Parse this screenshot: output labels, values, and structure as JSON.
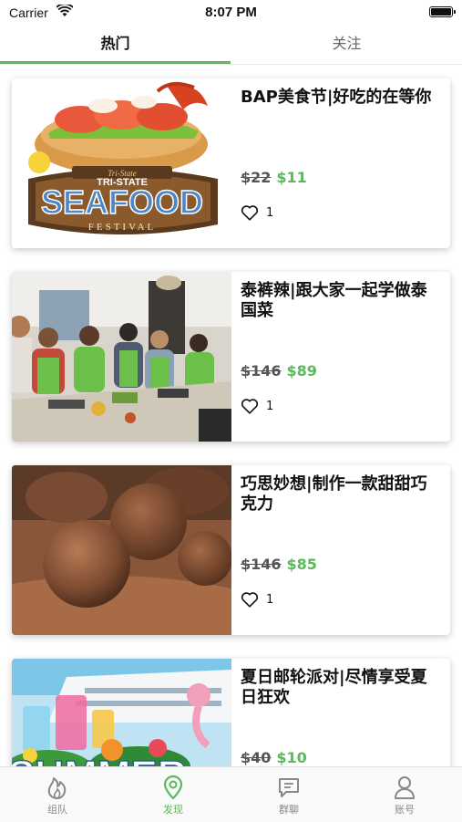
{
  "status": {
    "carrier": "Carrier",
    "time": "8:07 PM"
  },
  "tabs": [
    {
      "label": "热门"
    },
    {
      "label": "关注"
    }
  ],
  "cards": [
    {
      "title": "BAP美食节|好吃的在等你",
      "old_price": "$22",
      "new_price": "$11",
      "likes": "1",
      "image_text": [
        "Tri-State",
        "TRI-STATE",
        "SEAFOOD",
        "FESTIVAL"
      ]
    },
    {
      "title": "泰裤辣|跟大家一起学做泰国菜",
      "old_price": "$146",
      "new_price": "$89",
      "likes": "1"
    },
    {
      "title": "巧思妙想|制作一款甜甜巧克力",
      "old_price": "$146",
      "new_price": "$85",
      "likes": "1"
    },
    {
      "title": "夏日邮轮派对|尽情享受夏日狂欢",
      "old_price": "$40",
      "new_price": "$10",
      "likes": "",
      "image_text": [
        "SUMMER"
      ]
    }
  ],
  "bottom_nav": [
    {
      "label": "组队",
      "icon": "flame-icon"
    },
    {
      "label": "发现",
      "icon": "location-pin-icon"
    },
    {
      "label": "群聊",
      "icon": "chat-bubble-icon"
    },
    {
      "label": "账号",
      "icon": "user-icon"
    }
  ],
  "colors": {
    "accent": "#5cb85c",
    "text": "#111111",
    "muted": "#888888"
  }
}
